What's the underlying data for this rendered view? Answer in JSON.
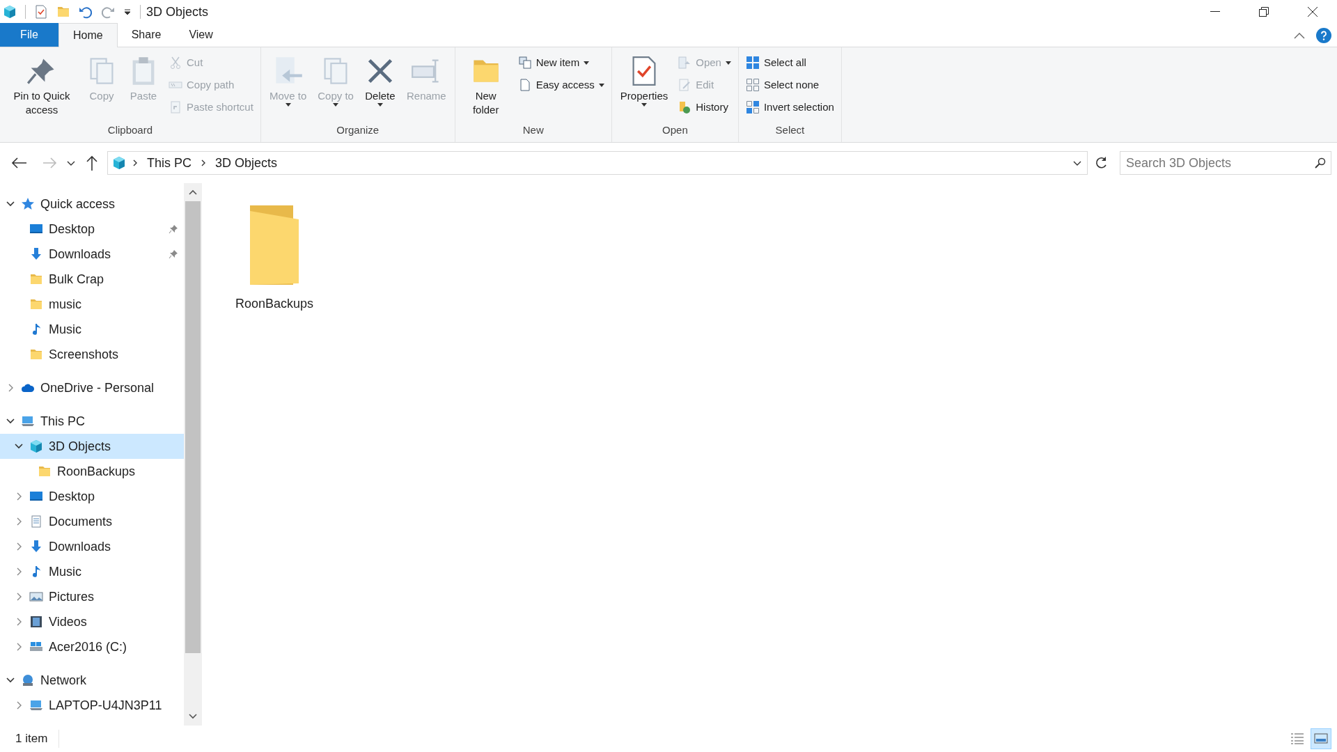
{
  "window": {
    "title": "3D Objects"
  },
  "ribbon_tabs": [
    {
      "label": "File",
      "kind": "file",
      "selected": false
    },
    {
      "label": "Home",
      "kind": "tab",
      "selected": true
    },
    {
      "label": "Share",
      "kind": "tab",
      "selected": false
    },
    {
      "label": "View",
      "kind": "tab",
      "selected": false
    }
  ],
  "ribbon_groups": [
    {
      "label": "Clipboard",
      "commands": [
        {
          "label": "Pin to Quick access",
          "kind": "pin",
          "disabled": false,
          "has_menu": false
        },
        {
          "label": "Copy",
          "kind": "copy",
          "disabled": true,
          "has_menu": false
        },
        {
          "label": "Paste",
          "kind": "paste",
          "disabled": true,
          "has_menu": false
        },
        {
          "kind": "stack",
          "items": [
            {
              "label": "Cut",
              "kind": "cut",
              "disabled": true,
              "has_menu": false
            },
            {
              "label": "Copy path",
              "kind": "copypath",
              "disabled": true,
              "has_menu": false
            },
            {
              "label": "Paste shortcut",
              "kind": "pasteshortcut",
              "disabled": true,
              "has_menu": false
            }
          ]
        }
      ]
    },
    {
      "label": "Organize",
      "commands": [
        {
          "label": "Move to",
          "kind": "move",
          "disabled": true,
          "has_menu": true
        },
        {
          "label": "Copy to",
          "kind": "copyto",
          "disabled": true,
          "has_menu": true
        },
        {
          "label": "Delete",
          "kind": "delete",
          "disabled": false,
          "has_menu": true
        },
        {
          "label": "Rename",
          "kind": "rename",
          "disabled": true,
          "has_menu": false
        }
      ]
    },
    {
      "label": "New",
      "commands": [
        {
          "label": "New folder",
          "kind": "folder",
          "disabled": false,
          "has_menu": false
        },
        {
          "kind": "stack",
          "items": [
            {
              "label": "New item",
              "kind": "newitem",
              "disabled": false,
              "has_menu": true
            },
            {
              "label": "Easy access",
              "kind": "easy",
              "disabled": false,
              "has_menu": true
            }
          ]
        }
      ]
    },
    {
      "label": "Open",
      "commands": [
        {
          "label": "Properties",
          "kind": "properties",
          "disabled": false,
          "has_menu": true
        },
        {
          "kind": "stack",
          "items": [
            {
              "label": "Open",
              "kind": "open",
              "disabled": true,
              "has_menu": true
            },
            {
              "label": "Edit",
              "kind": "edit",
              "disabled": true,
              "has_menu": false
            },
            {
              "label": "History",
              "kind": "history",
              "disabled": false,
              "has_menu": false
            }
          ]
        }
      ]
    },
    {
      "label": "Select",
      "commands": [
        {
          "kind": "stack",
          "items": [
            {
              "label": "Select all",
              "kind": "selectall",
              "disabled": false,
              "has_menu": false
            },
            {
              "label": "Select none",
              "kind": "selectnone",
              "disabled": false,
              "has_menu": false
            },
            {
              "label": "Invert selection",
              "kind": "invert",
              "disabled": false,
              "has_menu": false
            }
          ]
        }
      ]
    }
  ],
  "address_bar": {
    "path": [
      "This PC",
      "3D Objects"
    ]
  },
  "search": {
    "placeholder": "Search 3D Objects"
  },
  "navigation": [
    {
      "label": "Quick access",
      "kind": "star",
      "expanded": true,
      "selected": false,
      "children": [
        {
          "label": "Desktop",
          "kind": "desktop",
          "pinned": true,
          "selected": false
        },
        {
          "label": "Downloads",
          "kind": "download",
          "pinned": true,
          "selected": false
        },
        {
          "label": "Bulk Crap",
          "kind": "folder",
          "pinned": false,
          "selected": false
        },
        {
          "label": "music",
          "kind": "folder",
          "pinned": false,
          "selected": false
        },
        {
          "label": "Music",
          "kind": "music",
          "pinned": false,
          "selected": false
        },
        {
          "label": "Screenshots",
          "kind": "folder",
          "pinned": false,
          "selected": false
        }
      ]
    },
    {
      "label": "OneDrive - Personal",
      "kind": "cloud",
      "expanded": false,
      "selected": false
    },
    {
      "label": "This PC",
      "kind": "pc",
      "expanded": true,
      "selected": false,
      "children": [
        {
          "label": "3D Objects",
          "kind": "cube",
          "expanded": true,
          "selected": true,
          "children": [
            {
              "label": "RoonBackups",
              "kind": "folder",
              "selected": false
            }
          ]
        },
        {
          "label": "Desktop",
          "kind": "desktop",
          "expanded": false,
          "selected": false
        },
        {
          "label": "Documents",
          "kind": "document",
          "expanded": false,
          "selected": false
        },
        {
          "label": "Downloads",
          "kind": "download",
          "expanded": false,
          "selected": false
        },
        {
          "label": "Music",
          "kind": "music",
          "expanded": false,
          "selected": false
        },
        {
          "label": "Pictures",
          "kind": "picture",
          "expanded": false,
          "selected": false
        },
        {
          "label": "Videos",
          "kind": "video",
          "expanded": false,
          "selected": false
        },
        {
          "label": "Acer2016 (C:)",
          "kind": "drive",
          "expanded": false,
          "selected": false
        }
      ]
    },
    {
      "label": "Network",
      "kind": "network",
      "expanded": true,
      "selected": false,
      "children": [
        {
          "label": "LAPTOP-U4JN3P11",
          "kind": "pc",
          "expanded": false,
          "selected": false
        }
      ]
    }
  ],
  "files": [
    {
      "name": "RoonBackups",
      "selected": false
    }
  ],
  "status_bar": {
    "item_count": "1 item"
  },
  "view_buttons": [
    {
      "kind": "details",
      "selected": false
    },
    {
      "kind": "large_icons",
      "selected": true
    }
  ]
}
